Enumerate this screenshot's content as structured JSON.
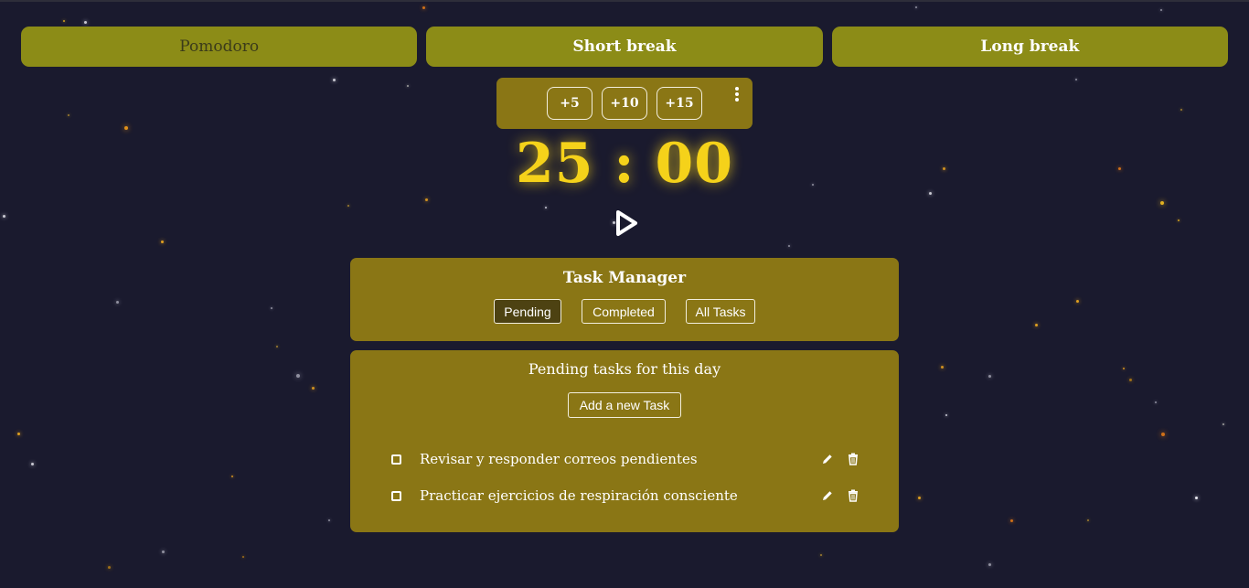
{
  "modes": [
    {
      "label": "Pomodoro",
      "active": true
    },
    {
      "label": "Short break",
      "active": false
    },
    {
      "label": "Long break",
      "active": false
    }
  ],
  "adders": [
    "+5",
    "+10",
    "+15"
  ],
  "timer": "25 : 00",
  "task_manager": {
    "title": "Task Manager",
    "tabs": [
      "Pending",
      "Completed",
      "All Tasks"
    ],
    "active_tab": "Pending"
  },
  "pending": {
    "title": "Pending tasks for this day",
    "add_label": "Add a new Task",
    "tasks": [
      "Revisar y responder correos pendientes",
      "Practicar ejercicios de respiración consciente"
    ]
  },
  "colors": {
    "background": "#1a1a2e",
    "mode_button": "#8c8c17",
    "panel": "#8a7615",
    "timer": "#f5d21a",
    "active_tab": "#4d4212"
  },
  "icons": [
    "more-vertical-icon",
    "play-icon",
    "edit-icon",
    "trash-icon",
    "checkbox-icon"
  ]
}
